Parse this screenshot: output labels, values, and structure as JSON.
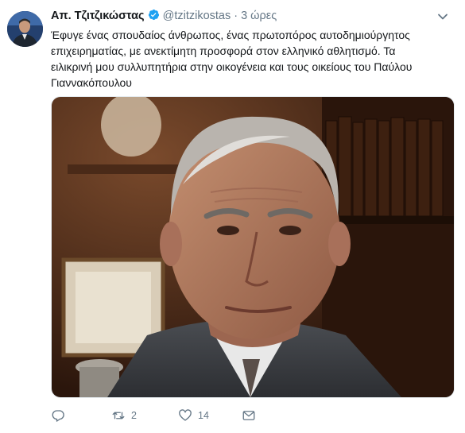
{
  "tweet": {
    "author_name": "Απ. Τζιτζικώστας",
    "handle": "@tzitzikostas",
    "separator": "·",
    "time": "3 ώρες",
    "text_lines": [
      "Έφυγε ένας σπουδαίος άνθρωπος, ένας πρωτοπόρος αυτοδημιούργητος",
      "επιχειρηματίας, με ανεκτίμητη προσφορά στον ελληνικό αθλητισμό. Τα",
      "ειλικρινή μου συλλυπητήρια στην οικογένεια και τους οικείους του Παύλου",
      "Γιαννακόπουλου"
    ],
    "actions": {
      "reply_count": "",
      "retweet_count": "2",
      "like_count": "14"
    }
  },
  "icons": {
    "avatar": "avatar",
    "verified": "verified-badge-icon",
    "caret": "chevron-down-icon",
    "reply": "reply-icon",
    "retweet": "retweet-icon",
    "like": "heart-icon",
    "dm": "envelope-icon"
  },
  "colors": {
    "text": "#14171a",
    "secondary": "#657786",
    "verified": "#1da1f2"
  }
}
